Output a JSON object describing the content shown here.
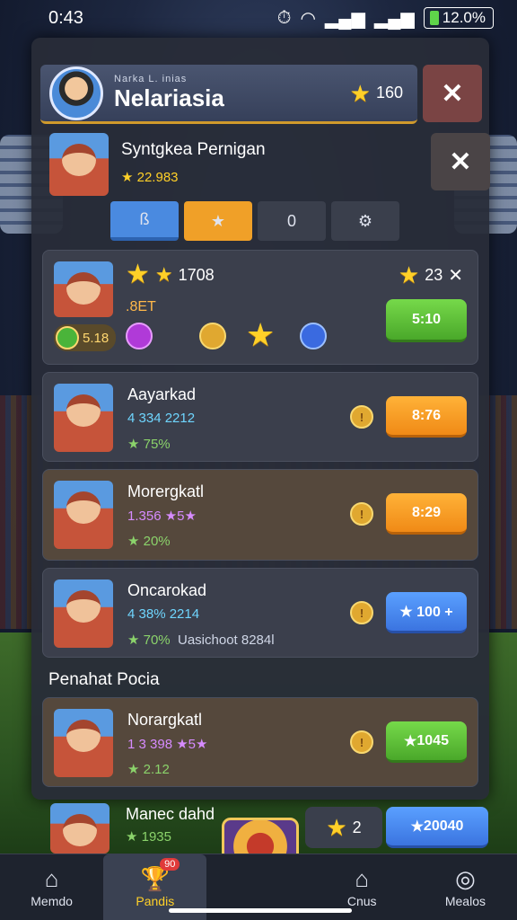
{
  "status": {
    "time": "0:43",
    "battery": "12.0%"
  },
  "header": {
    "subtitle": "Narka L. inias",
    "title": "Nelariasia",
    "coins": "160"
  },
  "player": {
    "name": "Syntgkea Pernigan",
    "score": "22.983"
  },
  "tabs": [
    "ß",
    "★",
    "0",
    "⚙"
  ],
  "featured": {
    "stat": "1708",
    "sub": ".8ET",
    "badge_value": "5.18",
    "stars": "23",
    "button": "5:10"
  },
  "rows": [
    {
      "name": "Aayarkad",
      "stat1": "4 334 2212",
      "stat2": "75%",
      "button": "8:76",
      "btn_color": "orange"
    },
    {
      "name": "Morergkatl",
      "stat1": "1.356 ★5★",
      "stat2": "20%",
      "button": "8:29",
      "btn_color": "orange"
    },
    {
      "name": "Oncarokad",
      "stat1": "4 38% 2214",
      "stat2": "70%",
      "extra": "Uasichoot 8284l",
      "button": "★ 100 +",
      "btn_color": "blue"
    }
  ],
  "section_title": "Penahat Pocia",
  "section_row": {
    "name": "Norargkatl",
    "stat1": "1 3 398 ★5★",
    "stat2": "2.12",
    "button": "1045"
  },
  "bottom_row": {
    "name": "Manec dahd",
    "stat": "1935",
    "stars": "2",
    "button": "20040",
    "notif": "90"
  },
  "nav": [
    {
      "label": "Memdo",
      "icon": "home-icon"
    },
    {
      "label": "Pandis",
      "icon": "trophy-icon"
    },
    {
      "label": "",
      "icon": "chest-icon"
    },
    {
      "label": "Cnus",
      "icon": "house-icon"
    },
    {
      "label": "Mealos",
      "icon": "target-icon"
    }
  ],
  "colors": {
    "accent": "#f0a028",
    "blue": "#4a8ae0",
    "green": "#5ac23a"
  }
}
